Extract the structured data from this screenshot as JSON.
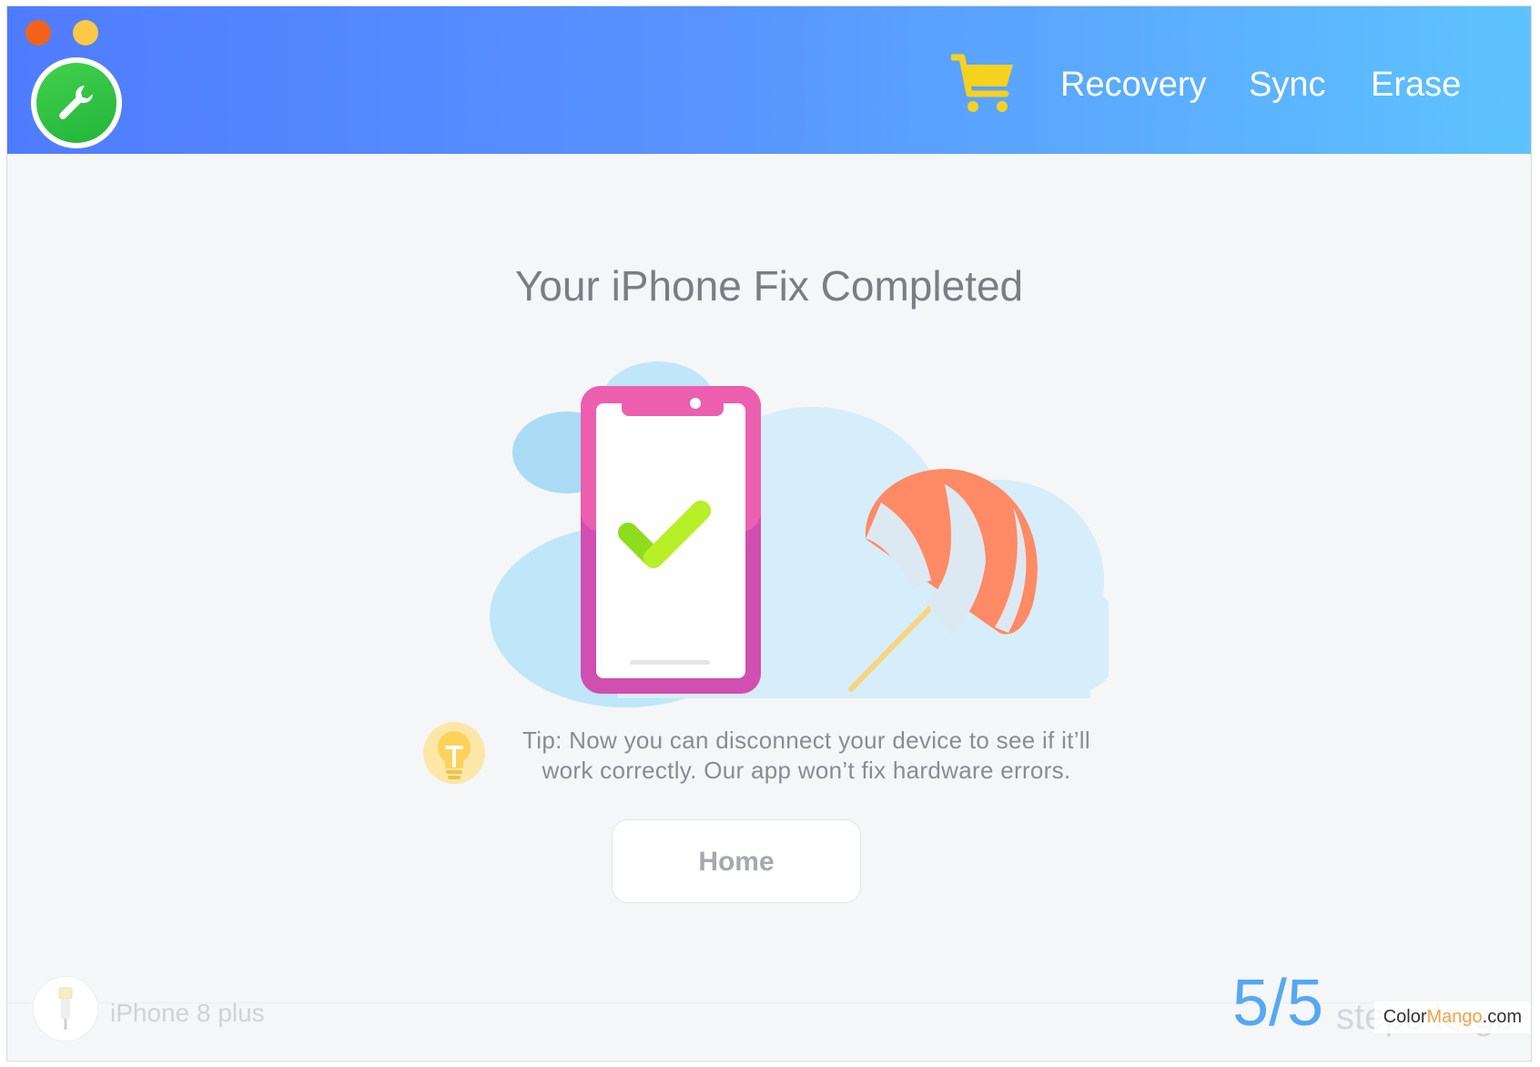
{
  "window": {
    "controls": [
      {
        "name": "close-button",
        "color": "#f2621b"
      },
      {
        "name": "minimize-button",
        "color": "#fdc844"
      }
    ],
    "app_icon": "wrench-icon"
  },
  "header": {
    "cart_icon": "shopping-cart-icon",
    "nav": {
      "recovery": "Recovery",
      "sync": "Sync",
      "erase": "Erase"
    },
    "gradient": [
      "#4f7cff",
      "#5ec3ff"
    ]
  },
  "main": {
    "title": "Your iPhone Fix Completed",
    "illustration": [
      "phone-checkmark-icon",
      "beach-umbrella-icon",
      "cloud-icon"
    ],
    "tip": {
      "icon": "lightbulb-icon",
      "line1": "Tip: Now you can disconnect your device to see if it’ll",
      "line2": "work correctly. Our app won’t fix hardware errors."
    },
    "home_button": "Home"
  },
  "footer": {
    "device_icon": "phone-cable-icon",
    "device_name": "iPhone 8 plus",
    "steps_count": "5/5",
    "steps_label": "steps to go",
    "watermark_a": "Color",
    "watermark_b": "Mango",
    "watermark_c": ".com"
  }
}
